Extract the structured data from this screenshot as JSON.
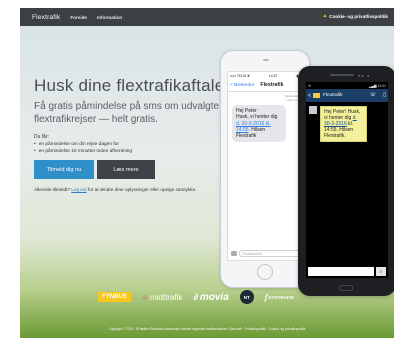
{
  "topbar": {
    "brand": "Flextrafik",
    "nav": [
      "Forside",
      "Information"
    ],
    "cookie_label": "Cookie- og privatlivspolitik",
    "cookie_icon": "warning-icon"
  },
  "hero": {
    "headline": "Husk dine flextrafikaftaler",
    "subline": "Få gratis påmindelse på sms om udvalgte flextrafikrejser — helt gratis.",
    "du_faar": "Du får:",
    "bullets": [
      "en påmindelse om din rejse dagen for",
      "en påmindelse 10 minutter inden afhentning"
    ],
    "primary_button": "Tilmeld dig nu",
    "secondary_button": "Læs mere",
    "registered_before": "Allerede tilmeldt? ",
    "registered_link": "Log ind",
    "registered_after": " for at ændre dine oplysninger eller opsige samtykke."
  },
  "iphone": {
    "carrier": "••••• TELIA ❦",
    "clock": "14.57",
    "battery": "▮▮▮",
    "back_label": "< Beskeder",
    "title": "Flextrafik",
    "timestamp": "Tekstbesked\nI dag 14.55",
    "message_greeting": "Hej Peter",
    "message_line": "Husk, vi henter dig ",
    "message_link": "d. 30-3-2016 kl. 14:55",
    "message_sign": ". Hilsen Flextrafik",
    "input_placeholder": "Tekstbesked"
  },
  "android": {
    "status_left": "✉",
    "status_right": "14:02",
    "title": "Flextrafik",
    "message_before": "Hej Peter! Husk, vi henter dig ",
    "message_link": "d. 30-3-2016",
    "message_after": " kl. 14:55. Hilsen Flextrafik."
  },
  "partners": {
    "fynbus": "FYNBUS",
    "midttrafik": "midttrafik",
    "movia": "movia",
    "nt": "NT",
    "sydtrafik": "SYDTRAFIK"
  },
  "footer": {
    "text": "Copyright © 2016 · Et fælles Flextrafik-samarbejde mellem regionale trafikselskaber i Danmark · Privatlivspolitik · Cookie- og privatlivspolitik"
  }
}
